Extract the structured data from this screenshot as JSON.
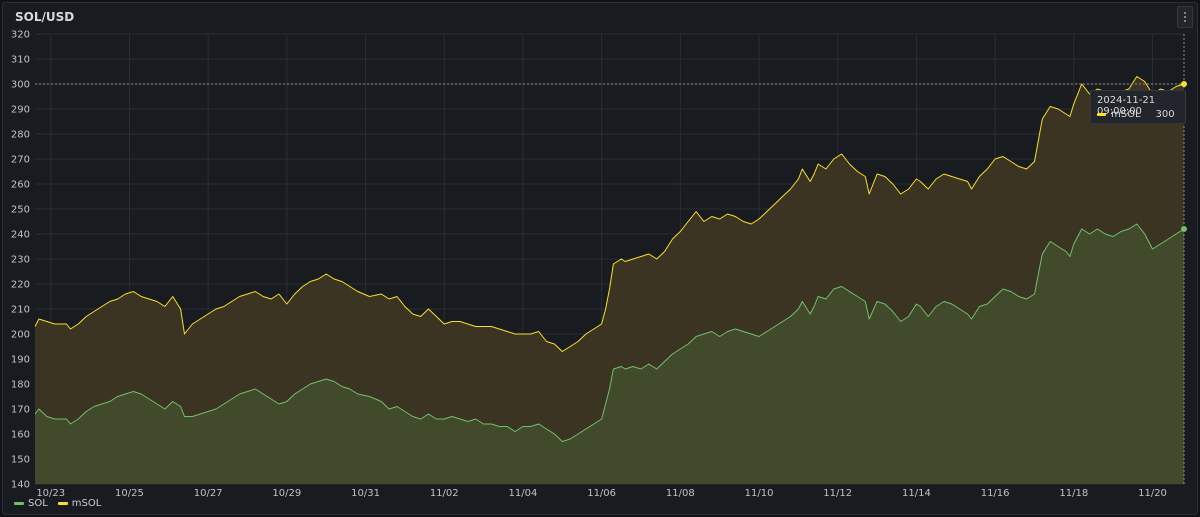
{
  "panel": {
    "title": "SOL/USD"
  },
  "tooltip": {
    "time": "2024-11-21 09:00:00",
    "series": "mSOL",
    "value": "300"
  },
  "colors": {
    "background": "#181b1f",
    "sol": "#73bf69",
    "msol": "#fade2a",
    "grid": "#2a2d33",
    "sol_fill": "#414a2b",
    "msol_fill": "#3b3423"
  },
  "chart_data": {
    "type": "area",
    "ylim": [
      140,
      320
    ],
    "yticks": [
      140,
      150,
      160,
      170,
      180,
      190,
      200,
      210,
      220,
      230,
      240,
      250,
      260,
      270,
      280,
      290,
      300,
      310,
      320
    ],
    "xlim": [
      0,
      29.2
    ],
    "xticks": [
      {
        "x": 0.4,
        "label": "10/23"
      },
      {
        "x": 2.4,
        "label": "10/25"
      },
      {
        "x": 4.4,
        "label": "10/27"
      },
      {
        "x": 6.4,
        "label": "10/29"
      },
      {
        "x": 8.4,
        "label": "10/31"
      },
      {
        "x": 10.4,
        "label": "11/02"
      },
      {
        "x": 12.4,
        "label": "11/04"
      },
      {
        "x": 14.4,
        "label": "11/06"
      },
      {
        "x": 16.4,
        "label": "11/08"
      },
      {
        "x": 18.4,
        "label": "11/10"
      },
      {
        "x": 20.4,
        "label": "11/12"
      },
      {
        "x": 22.4,
        "label": "11/14"
      },
      {
        "x": 24.4,
        "label": "11/16"
      },
      {
        "x": 26.4,
        "label": "11/18"
      },
      {
        "x": 28.4,
        "label": "11/20"
      }
    ],
    "grid": true,
    "legend_position": "bottom-left",
    "series": [
      {
        "name": "SOL",
        "color": "#73bf69",
        "points": [
          [
            0.0,
            168
          ],
          [
            0.1,
            170
          ],
          [
            0.3,
            167
          ],
          [
            0.5,
            166
          ],
          [
            0.8,
            166
          ],
          [
            0.9,
            164
          ],
          [
            1.1,
            166
          ],
          [
            1.3,
            169
          ],
          [
            1.5,
            171
          ],
          [
            1.7,
            172
          ],
          [
            1.9,
            173
          ],
          [
            2.1,
            175
          ],
          [
            2.3,
            176
          ],
          [
            2.5,
            177
          ],
          [
            2.7,
            176
          ],
          [
            2.9,
            174
          ],
          [
            3.1,
            172
          ],
          [
            3.3,
            170
          ],
          [
            3.5,
            173
          ],
          [
            3.7,
            171
          ],
          [
            3.8,
            167
          ],
          [
            4.0,
            167
          ],
          [
            4.2,
            168
          ],
          [
            4.4,
            169
          ],
          [
            4.6,
            170
          ],
          [
            4.8,
            172
          ],
          [
            5.0,
            174
          ],
          [
            5.2,
            176
          ],
          [
            5.4,
            177
          ],
          [
            5.6,
            178
          ],
          [
            5.8,
            176
          ],
          [
            6.0,
            174
          ],
          [
            6.2,
            172
          ],
          [
            6.4,
            173
          ],
          [
            6.6,
            176
          ],
          [
            6.8,
            178
          ],
          [
            7.0,
            180
          ],
          [
            7.2,
            181
          ],
          [
            7.4,
            182
          ],
          [
            7.6,
            181
          ],
          [
            7.8,
            179
          ],
          [
            8.0,
            178
          ],
          [
            8.2,
            176
          ],
          [
            8.5,
            175
          ],
          [
            8.8,
            173
          ],
          [
            9.0,
            170
          ],
          [
            9.2,
            171
          ],
          [
            9.4,
            169
          ],
          [
            9.6,
            167
          ],
          [
            9.8,
            166
          ],
          [
            10.0,
            168
          ],
          [
            10.2,
            166
          ],
          [
            10.4,
            166
          ],
          [
            10.6,
            167
          ],
          [
            10.8,
            166
          ],
          [
            11.0,
            165
          ],
          [
            11.2,
            166
          ],
          [
            11.4,
            164
          ],
          [
            11.6,
            164
          ],
          [
            11.8,
            163
          ],
          [
            12.0,
            163
          ],
          [
            12.2,
            161
          ],
          [
            12.4,
            163
          ],
          [
            12.6,
            163
          ],
          [
            12.8,
            164
          ],
          [
            13.0,
            162
          ],
          [
            13.2,
            160
          ],
          [
            13.4,
            157
          ],
          [
            13.6,
            158
          ],
          [
            13.8,
            160
          ],
          [
            14.0,
            162
          ],
          [
            14.2,
            164
          ],
          [
            14.4,
            166
          ],
          [
            14.5,
            172
          ],
          [
            14.6,
            178
          ],
          [
            14.7,
            186
          ],
          [
            14.9,
            187
          ],
          [
            15.0,
            186
          ],
          [
            15.2,
            187
          ],
          [
            15.4,
            186
          ],
          [
            15.6,
            188
          ],
          [
            15.8,
            186
          ],
          [
            16.0,
            189
          ],
          [
            16.2,
            192
          ],
          [
            16.4,
            194
          ],
          [
            16.6,
            196
          ],
          [
            16.8,
            199
          ],
          [
            17.0,
            200
          ],
          [
            17.2,
            201
          ],
          [
            17.4,
            199
          ],
          [
            17.6,
            201
          ],
          [
            17.8,
            202
          ],
          [
            18.0,
            201
          ],
          [
            18.2,
            200
          ],
          [
            18.4,
            199
          ],
          [
            18.6,
            201
          ],
          [
            18.8,
            203
          ],
          [
            19.0,
            205
          ],
          [
            19.2,
            207
          ],
          [
            19.4,
            210
          ],
          [
            19.5,
            213
          ],
          [
            19.7,
            208
          ],
          [
            19.8,
            211
          ],
          [
            19.9,
            215
          ],
          [
            20.1,
            214
          ],
          [
            20.3,
            218
          ],
          [
            20.5,
            219
          ],
          [
            20.7,
            217
          ],
          [
            20.9,
            215
          ],
          [
            21.1,
            213
          ],
          [
            21.2,
            206
          ],
          [
            21.4,
            213
          ],
          [
            21.6,
            212
          ],
          [
            21.8,
            209
          ],
          [
            22.0,
            205
          ],
          [
            22.2,
            207
          ],
          [
            22.4,
            212
          ],
          [
            22.5,
            211
          ],
          [
            22.7,
            207
          ],
          [
            22.9,
            211
          ],
          [
            23.1,
            213
          ],
          [
            23.3,
            212
          ],
          [
            23.5,
            210
          ],
          [
            23.7,
            208
          ],
          [
            23.8,
            206
          ],
          [
            24.0,
            211
          ],
          [
            24.2,
            212
          ],
          [
            24.4,
            215
          ],
          [
            24.6,
            218
          ],
          [
            24.8,
            217
          ],
          [
            25.0,
            215
          ],
          [
            25.2,
            214
          ],
          [
            25.4,
            216
          ],
          [
            25.6,
            232
          ],
          [
            25.8,
            237
          ],
          [
            26.0,
            235
          ],
          [
            26.2,
            233
          ],
          [
            26.3,
            231
          ],
          [
            26.4,
            236
          ],
          [
            26.6,
            242
          ],
          [
            26.8,
            240
          ],
          [
            27.0,
            242
          ],
          [
            27.2,
            240
          ],
          [
            27.4,
            239
          ],
          [
            27.6,
            241
          ],
          [
            27.8,
            242
          ],
          [
            28.0,
            244
          ],
          [
            28.2,
            240
          ],
          [
            28.4,
            234
          ],
          [
            28.6,
            236
          ],
          [
            28.8,
            238
          ],
          [
            29.0,
            240
          ],
          [
            29.2,
            242
          ]
        ]
      },
      {
        "name": "mSOL",
        "color": "#fade2a",
        "points": [
          [
            0.0,
            203
          ],
          [
            0.1,
            206
          ],
          [
            0.3,
            205
          ],
          [
            0.5,
            204
          ],
          [
            0.8,
            204
          ],
          [
            0.9,
            202
          ],
          [
            1.1,
            204
          ],
          [
            1.3,
            207
          ],
          [
            1.5,
            209
          ],
          [
            1.7,
            211
          ],
          [
            1.9,
            213
          ],
          [
            2.1,
            214
          ],
          [
            2.3,
            216
          ],
          [
            2.5,
            217
          ],
          [
            2.7,
            215
          ],
          [
            2.9,
            214
          ],
          [
            3.1,
            213
          ],
          [
            3.3,
            211
          ],
          [
            3.5,
            215
          ],
          [
            3.7,
            210
          ],
          [
            3.8,
            200
          ],
          [
            4.0,
            204
          ],
          [
            4.2,
            206
          ],
          [
            4.4,
            208
          ],
          [
            4.6,
            210
          ],
          [
            4.8,
            211
          ],
          [
            5.0,
            213
          ],
          [
            5.2,
            215
          ],
          [
            5.4,
            216
          ],
          [
            5.6,
            217
          ],
          [
            5.8,
            215
          ],
          [
            6.0,
            214
          ],
          [
            6.2,
            216
          ],
          [
            6.4,
            212
          ],
          [
            6.6,
            216
          ],
          [
            6.8,
            219
          ],
          [
            7.0,
            221
          ],
          [
            7.2,
            222
          ],
          [
            7.4,
            224
          ],
          [
            7.6,
            222
          ],
          [
            7.8,
            221
          ],
          [
            8.0,
            219
          ],
          [
            8.2,
            217
          ],
          [
            8.5,
            215
          ],
          [
            8.8,
            216
          ],
          [
            9.0,
            214
          ],
          [
            9.2,
            215
          ],
          [
            9.4,
            211
          ],
          [
            9.6,
            208
          ],
          [
            9.8,
            207
          ],
          [
            10.0,
            210
          ],
          [
            10.2,
            207
          ],
          [
            10.4,
            204
          ],
          [
            10.6,
            205
          ],
          [
            10.8,
            205
          ],
          [
            11.0,
            204
          ],
          [
            11.2,
            203
          ],
          [
            11.4,
            203
          ],
          [
            11.6,
            203
          ],
          [
            11.8,
            202
          ],
          [
            12.0,
            201
          ],
          [
            12.2,
            200
          ],
          [
            12.4,
            200
          ],
          [
            12.6,
            200
          ],
          [
            12.8,
            201
          ],
          [
            13.0,
            197
          ],
          [
            13.2,
            196
          ],
          [
            13.4,
            193
          ],
          [
            13.6,
            195
          ],
          [
            13.8,
            197
          ],
          [
            14.0,
            200
          ],
          [
            14.2,
            202
          ],
          [
            14.4,
            204
          ],
          [
            14.5,
            210
          ],
          [
            14.6,
            218
          ],
          [
            14.7,
            228
          ],
          [
            14.9,
            230
          ],
          [
            15.0,
            229
          ],
          [
            15.2,
            230
          ],
          [
            15.4,
            231
          ],
          [
            15.6,
            232
          ],
          [
            15.8,
            230
          ],
          [
            16.0,
            233
          ],
          [
            16.2,
            238
          ],
          [
            16.4,
            241
          ],
          [
            16.6,
            245
          ],
          [
            16.8,
            249
          ],
          [
            17.0,
            245
          ],
          [
            17.2,
            247
          ],
          [
            17.4,
            246
          ],
          [
            17.6,
            248
          ],
          [
            17.8,
            247
          ],
          [
            18.0,
            245
          ],
          [
            18.2,
            244
          ],
          [
            18.4,
            246
          ],
          [
            18.6,
            249
          ],
          [
            18.8,
            252
          ],
          [
            19.0,
            255
          ],
          [
            19.2,
            258
          ],
          [
            19.4,
            262
          ],
          [
            19.5,
            266
          ],
          [
            19.7,
            261
          ],
          [
            19.8,
            264
          ],
          [
            19.9,
            268
          ],
          [
            20.1,
            266
          ],
          [
            20.3,
            270
          ],
          [
            20.5,
            272
          ],
          [
            20.7,
            268
          ],
          [
            20.9,
            265
          ],
          [
            21.1,
            263
          ],
          [
            21.2,
            256
          ],
          [
            21.4,
            264
          ],
          [
            21.6,
            263
          ],
          [
            21.8,
            260
          ],
          [
            22.0,
            256
          ],
          [
            22.2,
            258
          ],
          [
            22.4,
            262
          ],
          [
            22.5,
            261
          ],
          [
            22.7,
            258
          ],
          [
            22.9,
            262
          ],
          [
            23.1,
            264
          ],
          [
            23.3,
            263
          ],
          [
            23.5,
            262
          ],
          [
            23.7,
            261
          ],
          [
            23.8,
            258
          ],
          [
            24.0,
            263
          ],
          [
            24.2,
            266
          ],
          [
            24.4,
            270
          ],
          [
            24.6,
            271
          ],
          [
            24.8,
            269
          ],
          [
            25.0,
            267
          ],
          [
            25.2,
            266
          ],
          [
            25.4,
            269
          ],
          [
            25.6,
            286
          ],
          [
            25.8,
            291
          ],
          [
            26.0,
            290
          ],
          [
            26.2,
            288
          ],
          [
            26.3,
            287
          ],
          [
            26.4,
            292
          ],
          [
            26.6,
            300
          ],
          [
            26.8,
            296
          ],
          [
            27.0,
            298
          ],
          [
            27.2,
            297
          ],
          [
            27.4,
            295
          ],
          [
            27.6,
            297
          ],
          [
            27.8,
            298
          ],
          [
            28.0,
            303
          ],
          [
            28.2,
            301
          ],
          [
            28.4,
            296
          ],
          [
            28.6,
            298
          ],
          [
            28.8,
            297
          ],
          [
            29.0,
            299
          ],
          [
            29.2,
            300
          ]
        ]
      }
    ]
  }
}
